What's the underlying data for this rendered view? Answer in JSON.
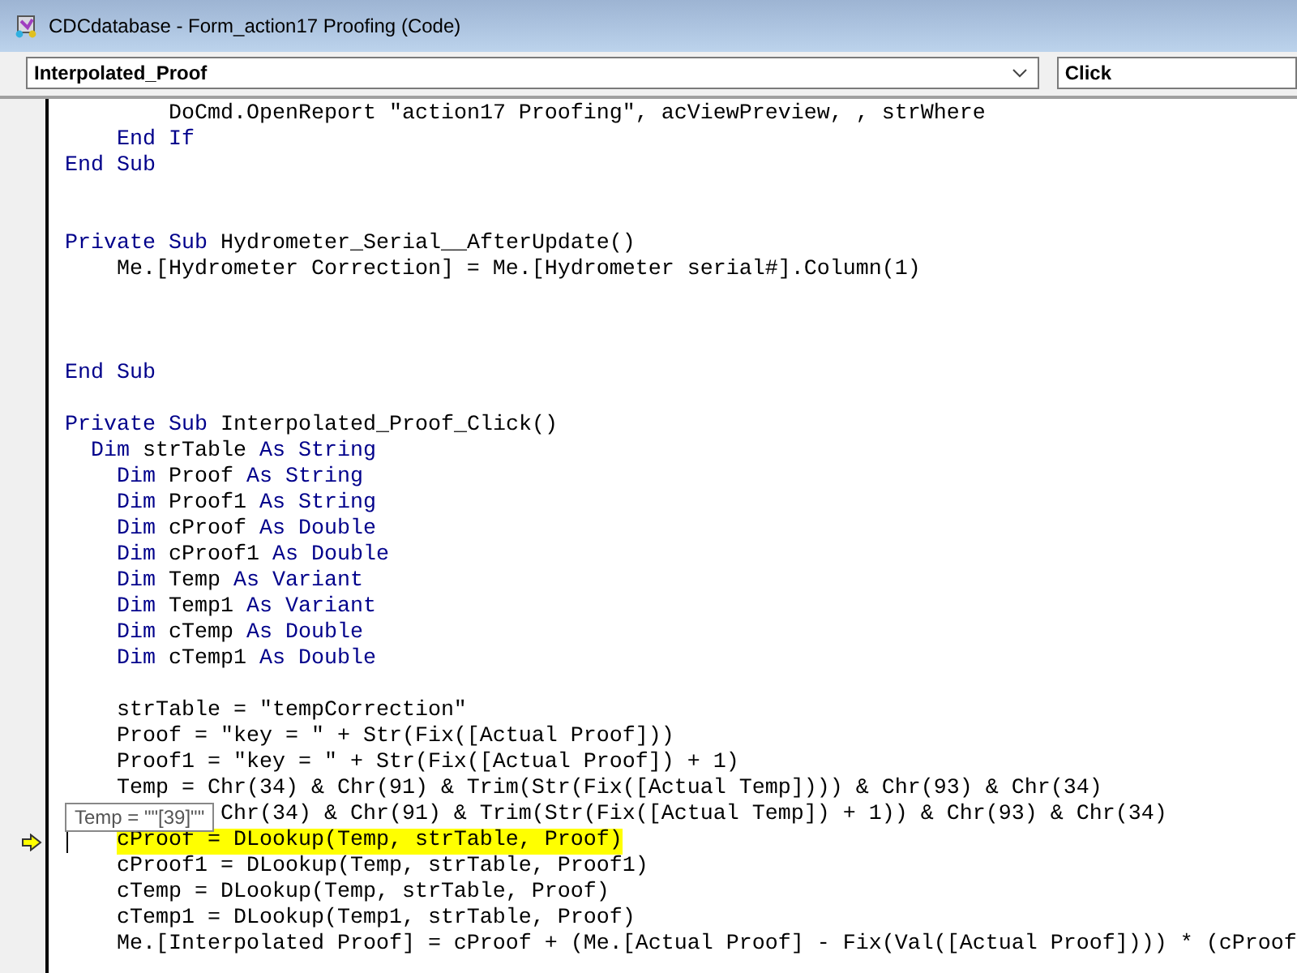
{
  "window": {
    "title": "CDCdatabase - Form_action17 Proofing (Code)"
  },
  "object_combo": {
    "value": "Interpolated_Proof"
  },
  "procedure_combo": {
    "value": "Click"
  },
  "code_lines": [
    {
      "kind": "deep",
      "current": false,
      "parts": [
        {
          "kind": "plain",
          "text": "DoCmd.OpenReport \"action17 Proofing\", acViewPreview, , strWhere"
        }
      ]
    },
    {
      "kind": "body",
      "current": false,
      "parts": [
        {
          "kind": "keyword",
          "text": "End If"
        }
      ]
    },
    {
      "kind": "flush",
      "current": false,
      "parts": [
        {
          "kind": "keyword",
          "text": "End Sub"
        }
      ]
    },
    {
      "kind": "blank",
      "current": false
    },
    {
      "kind": "blank",
      "current": false
    },
    {
      "kind": "flush",
      "current": false,
      "parts": [
        {
          "kind": "keyword",
          "text": "Private Sub"
        },
        {
          "kind": "plain",
          "text": "Hydrometer_Serial__AfterUpdate()"
        }
      ]
    },
    {
      "kind": "body",
      "current": false,
      "parts": [
        {
          "kind": "plain",
          "text": "Me.[Hydrometer Correction] = Me.[Hydrometer serial#].Column(1)"
        }
      ]
    },
    {
      "kind": "blank",
      "current": false
    },
    {
      "kind": "blank",
      "current": false
    },
    {
      "kind": "blank",
      "current": false
    },
    {
      "kind": "flush",
      "current": false,
      "parts": [
        {
          "kind": "keyword",
          "text": "End Sub"
        }
      ]
    },
    {
      "kind": "blank",
      "current": false
    },
    {
      "kind": "flush",
      "current": false,
      "parts": [
        {
          "kind": "keyword",
          "text": "Private Sub"
        },
        {
          "kind": "plain",
          "text": "Interpolated_Proof_Click()"
        }
      ]
    },
    {
      "kind": "half",
      "current": false,
      "parts": [
        {
          "kind": "keyword",
          "text": "Dim"
        },
        {
          "kind": "plain",
          "text": "strTable"
        },
        {
          "kind": "keyword",
          "text": "As String"
        }
      ]
    },
    {
      "kind": "body",
      "current": false,
      "parts": [
        {
          "kind": "keyword",
          "text": "Dim"
        },
        {
          "kind": "plain",
          "text": "Proof"
        },
        {
          "kind": "keyword",
          "text": "As String"
        }
      ]
    },
    {
      "kind": "body",
      "current": false,
      "parts": [
        {
          "kind": "keyword",
          "text": "Dim"
        },
        {
          "kind": "plain",
          "text": "Proof1"
        },
        {
          "kind": "keyword",
          "text": "As String"
        }
      ]
    },
    {
      "kind": "body",
      "current": false,
      "parts": [
        {
          "kind": "keyword",
          "text": "Dim"
        },
        {
          "kind": "plain",
          "text": "cProof"
        },
        {
          "kind": "keyword",
          "text": "As Double"
        }
      ]
    },
    {
      "kind": "body",
      "current": false,
      "parts": [
        {
          "kind": "keyword",
          "text": "Dim"
        },
        {
          "kind": "plain",
          "text": "cProof1"
        },
        {
          "kind": "keyword",
          "text": "As Double"
        }
      ]
    },
    {
      "kind": "body",
      "current": false,
      "parts": [
        {
          "kind": "keyword",
          "text": "Dim"
        },
        {
          "kind": "plain",
          "text": "Temp"
        },
        {
          "kind": "keyword",
          "text": "As Variant"
        }
      ]
    },
    {
      "kind": "body",
      "current": false,
      "parts": [
        {
          "kind": "keyword",
          "text": "Dim"
        },
        {
          "kind": "plain",
          "text": "Temp1"
        },
        {
          "kind": "keyword",
          "text": "As Variant"
        }
      ]
    },
    {
      "kind": "body",
      "current": false,
      "parts": [
        {
          "kind": "keyword",
          "text": "Dim"
        },
        {
          "kind": "plain",
          "text": "cTemp"
        },
        {
          "kind": "keyword",
          "text": "As Double"
        }
      ]
    },
    {
      "kind": "body",
      "current": false,
      "parts": [
        {
          "kind": "keyword",
          "text": "Dim"
        },
        {
          "kind": "plain",
          "text": "cTemp1"
        },
        {
          "kind": "keyword",
          "text": "As Double"
        }
      ]
    },
    {
      "kind": "blank",
      "current": false
    },
    {
      "kind": "body",
      "current": false,
      "parts": [
        {
          "kind": "plain",
          "text": "strTable = \"tempCorrection\""
        }
      ]
    },
    {
      "kind": "body",
      "current": false,
      "parts": [
        {
          "kind": "plain",
          "text": "Proof = \"key = \" + Str(Fix([Actual Proof]))"
        }
      ]
    },
    {
      "kind": "body",
      "current": false,
      "parts": [
        {
          "kind": "plain",
          "text": "Proof1 = \"key = \" + Str(Fix([Actual Proof]) + 1)"
        }
      ]
    },
    {
      "kind": "body",
      "current": false,
      "parts": [
        {
          "kind": "plain",
          "text": "Temp = Chr(34) & Chr(91) & Trim(Str(Fix([Actual Temp]))) & Chr(93) & Chr(34)"
        }
      ]
    },
    {
      "kind": "continued",
      "current": false,
      "parts": [
        {
          "kind": "plain",
          "text": "Chr(34) & Chr(91) & Trim(Str(Fix([Actual Temp]) + 1)) & Chr(93) & Chr(34)"
        }
      ]
    },
    {
      "kind": "body",
      "current": true,
      "parts": [
        {
          "kind": "plain",
          "text": "cProof = DLookup(Temp, strTable, Proof)"
        }
      ]
    },
    {
      "kind": "body",
      "current": false,
      "parts": [
        {
          "kind": "plain",
          "text": "cProof1 = DLookup(Temp, strTable, Proof1)"
        }
      ]
    },
    {
      "kind": "body",
      "current": false,
      "parts": [
        {
          "kind": "plain",
          "text": "cTemp = DLookup(Temp, strTable, Proof)"
        }
      ]
    },
    {
      "kind": "body",
      "current": false,
      "parts": [
        {
          "kind": "plain",
          "text": "cTemp1 = DLookup(Temp1, strTable, Proof)"
        }
      ]
    },
    {
      "kind": "body",
      "current": false,
      "parts": [
        {
          "kind": "plain",
          "text": "Me.[Interpolated Proof] = cProof + (Me.[Actual Proof] - Fix(Val([Actual Proof]))) * (cProof"
        }
      ]
    }
  ],
  "tooltip": {
    "text": "Temp = \"\"[39]\"\""
  }
}
